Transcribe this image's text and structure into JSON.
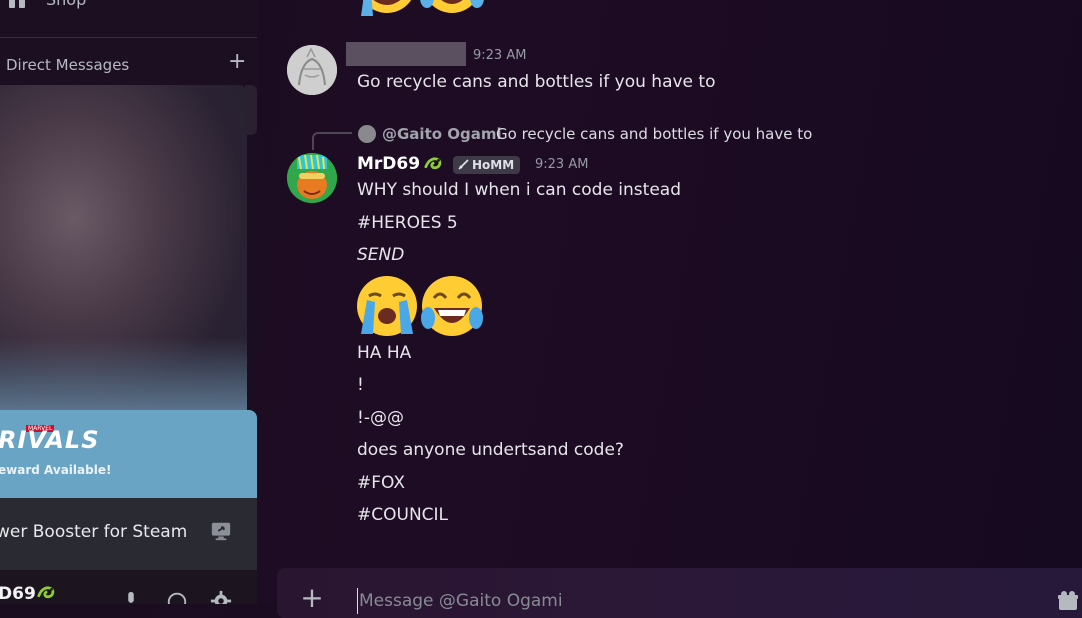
{
  "sidebar": {
    "shop_label": "Shop",
    "dm_header": "Direct Messages",
    "dm_add": "+",
    "promo": {
      "logo_top": "MARVEL",
      "logo": "RIVALS",
      "reward_text": "eward Available!"
    },
    "activity_name": "wer Booster for Steam",
    "user_name": "D69"
  },
  "chat": {
    "message1": {
      "time": "9:23 AM",
      "text": "Go recycle cans and bottles if you have to"
    },
    "reply": {
      "mention": "@Gaito Ogami",
      "text": "Go recycle cans and bottles if you have to"
    },
    "message2": {
      "author": "MrD69",
      "tag": "HoMM",
      "time": "9:23 AM",
      "lines": {
        "l1": "WHY should I when i can code instead",
        "l2": "#HEROES 5",
        "l3": "SEND",
        "l4": "HA HA",
        "l5": "!",
        "l6": "!-@@",
        "l7": "does anyone undertsand code?",
        "l8": "#FOX",
        "l9": "#COUNCIL"
      },
      "emojis": [
        "loudly-crying-face",
        "face-with-tears-of-joy"
      ]
    },
    "composer": {
      "placeholder": "Message @Gaito Ogami"
    }
  },
  "colors": {
    "accent_badge": "#3e3a48",
    "promo_bg": "#6aa4c4",
    "background": "#1e0c24"
  }
}
